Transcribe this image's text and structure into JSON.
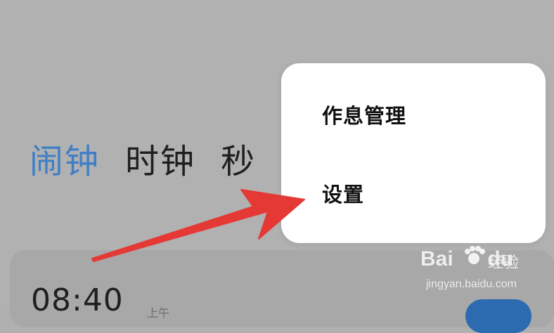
{
  "tabs": [
    {
      "label": "闹钟",
      "active": true
    },
    {
      "label": "时钟",
      "active": false
    },
    {
      "label": "秒",
      "active": false
    }
  ],
  "alarm": {
    "time": "08:40",
    "sub": "上午"
  },
  "menu": {
    "items": [
      {
        "label": "作息管理"
      },
      {
        "label": "设置"
      }
    ]
  },
  "annotation": {
    "arrow_color": "#e53935"
  },
  "watermark": {
    "brand_left": "Bai",
    "brand_right": "du",
    "suffix": "经验",
    "url": "jingyan.baidu.com"
  },
  "colors": {
    "accent_blue": "#3f7fc6",
    "overlay_gray": "#b1b1b1",
    "menu_bg": "#ffffff"
  }
}
